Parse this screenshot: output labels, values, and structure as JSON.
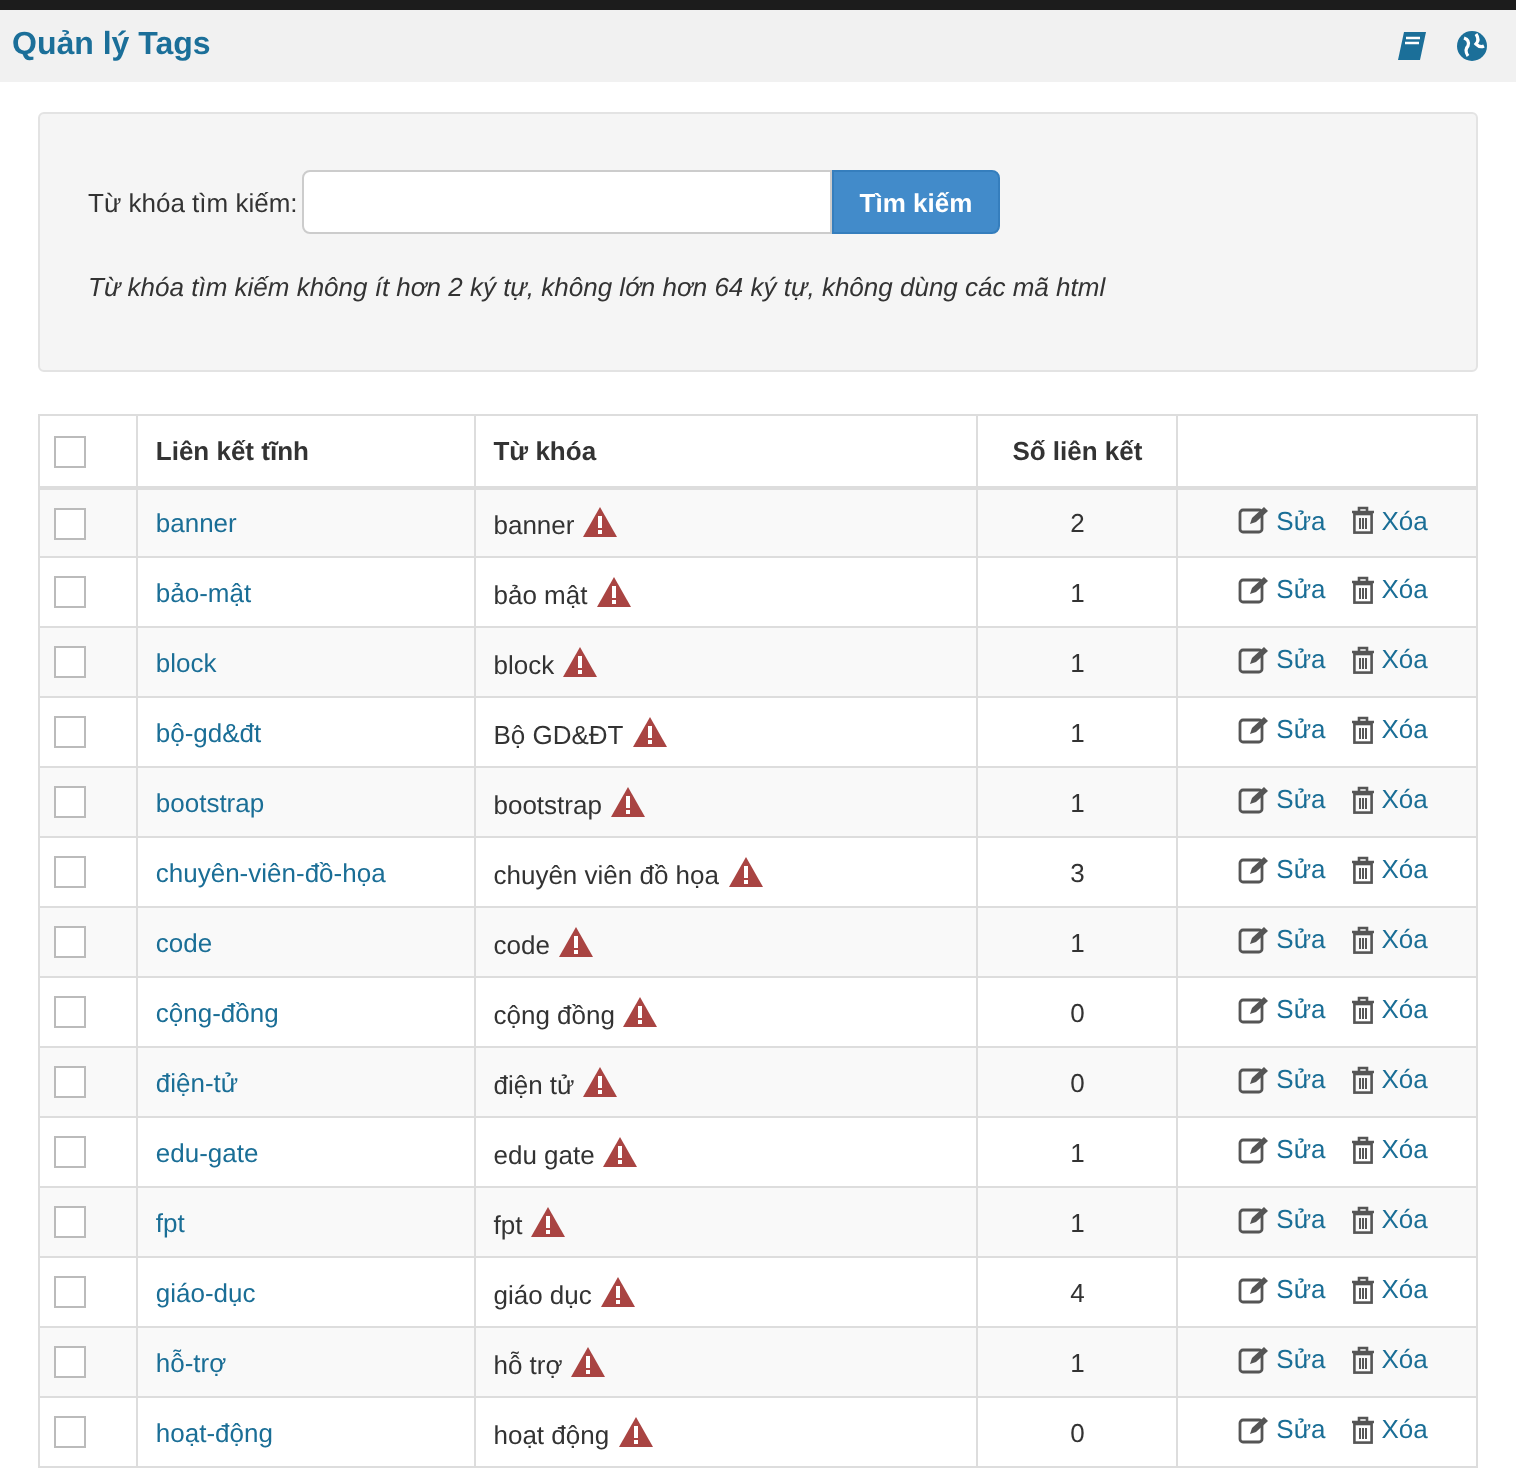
{
  "header": {
    "title": "Quản lý Tags"
  },
  "search": {
    "label": "Từ khóa tìm kiếm:",
    "button": "Tìm kiếm",
    "hint": "Từ khóa tìm kiếm không ít hơn 2 ký tự, không lớn hơn 64 ký tự, không dùng các mã html"
  },
  "table": {
    "columns": [
      "Liên kết tĩnh",
      "Từ khóa",
      "Số liên kết"
    ],
    "select_all_checked": false,
    "rows": [
      {
        "alias": "banner",
        "keyword": "banner",
        "count": "2",
        "checked": false,
        "edit": "Sửa",
        "delete": "Xóa"
      },
      {
        "alias": "bảo-mật",
        "keyword": "bảo mật",
        "count": "1",
        "checked": false,
        "edit": "Sửa",
        "delete": "Xóa"
      },
      {
        "alias": "block",
        "keyword": "block",
        "count": "1",
        "checked": false,
        "edit": "Sửa",
        "delete": "Xóa"
      },
      {
        "alias": "bộ-gd&đt",
        "keyword": "Bộ GD&ĐT",
        "count": "1",
        "checked": false,
        "edit": "Sửa",
        "delete": "Xóa"
      },
      {
        "alias": "bootstrap",
        "keyword": "bootstrap",
        "count": "1",
        "checked": false,
        "edit": "Sửa",
        "delete": "Xóa"
      },
      {
        "alias": "chuyên-viên-đồ-họa",
        "keyword": "chuyên viên đồ họa",
        "count": "3",
        "checked": false,
        "edit": "Sửa",
        "delete": "Xóa"
      },
      {
        "alias": "code",
        "keyword": "code",
        "count": "1",
        "checked": false,
        "edit": "Sửa",
        "delete": "Xóa"
      },
      {
        "alias": "cộng-đồng",
        "keyword": "cộng đồng",
        "count": "0",
        "checked": false,
        "edit": "Sửa",
        "delete": "Xóa"
      },
      {
        "alias": "điện-tử",
        "keyword": "điện tử",
        "count": "0",
        "checked": false,
        "edit": "Sửa",
        "delete": "Xóa"
      },
      {
        "alias": "edu-gate",
        "keyword": "edu gate",
        "count": "1",
        "checked": false,
        "edit": "Sửa",
        "delete": "Xóa"
      },
      {
        "alias": "fpt",
        "keyword": "fpt",
        "count": "1",
        "checked": false,
        "edit": "Sửa",
        "delete": "Xóa"
      },
      {
        "alias": "giáo-dục",
        "keyword": "giáo dục",
        "count": "4",
        "checked": false,
        "edit": "Sửa",
        "delete": "Xóa"
      },
      {
        "alias": "hỗ-trợ",
        "keyword": "hỗ trợ",
        "count": "1",
        "checked": false,
        "edit": "Sửa",
        "delete": "Xóa"
      },
      {
        "alias": "hoạt-động",
        "keyword": "hoạt động",
        "count": "0",
        "checked": false,
        "edit": "Sửa",
        "delete": "Xóa"
      }
    ]
  }
}
